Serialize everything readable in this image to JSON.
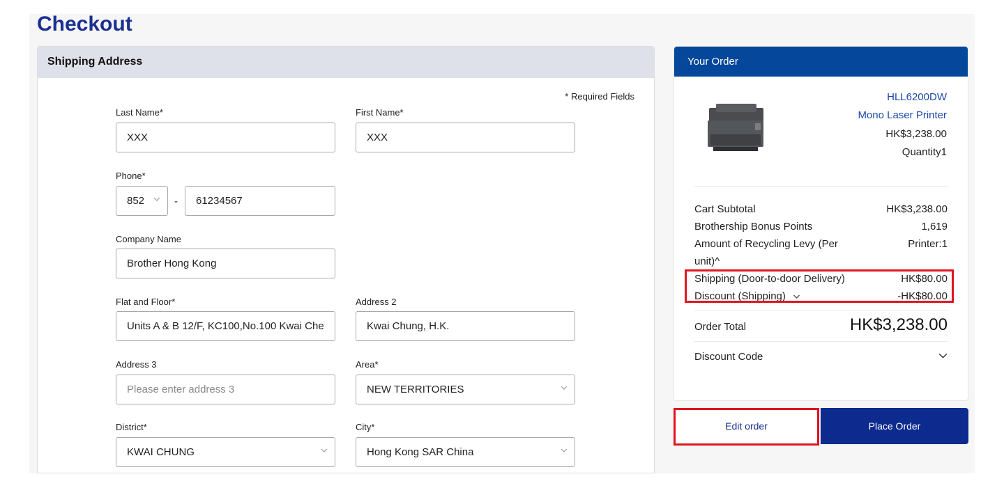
{
  "page": {
    "title": "Checkout"
  },
  "shipping": {
    "header": "Shipping Address",
    "required_note": "* Required Fields",
    "last_name": {
      "label": "Last Name*",
      "value": "XXX"
    },
    "first_name": {
      "label": "First Name*",
      "value": "XXX"
    },
    "phone": {
      "label": "Phone*",
      "country_code": "852",
      "separator": "-",
      "number": "61234567"
    },
    "company": {
      "label": "Company Name",
      "value": "Brother Hong Kong"
    },
    "flat_floor": {
      "label": "Flat and Floor*",
      "value": "Units A & B 12/F, KC100,No.100 Kwai Che"
    },
    "address2": {
      "label": "Address 2",
      "value": "Kwai Chung,  H.K."
    },
    "address3": {
      "label": "Address 3",
      "placeholder": "Please enter address 3"
    },
    "area": {
      "label": "Area*",
      "value": "NEW TERRITORIES"
    },
    "district": {
      "label": "District*",
      "value": "KWAI CHUNG"
    },
    "city": {
      "label": "City*",
      "value": "Hong Kong SAR China"
    }
  },
  "order": {
    "header": "Your Order",
    "product": {
      "model": "HLL6200DW",
      "name": "Mono Laser Printer",
      "price": "HK$3,238.00",
      "quantity": "Quantity1"
    },
    "summary": {
      "subtotal_label": "Cart Subtotal",
      "subtotal_value": "HK$3,238.00",
      "points_label": "Brothership Bonus Points",
      "points_value": "1,619",
      "levy_label_1": "Amount of Recycling Levy (Per",
      "levy_label_2": "unit)^",
      "levy_value": "Printer:1",
      "shipping_label": "Shipping (Door-to-door Delivery)",
      "shipping_value": "HK$80.00",
      "discount_label": "Discount (Shipping)",
      "discount_value": "-HK$80.00"
    },
    "total_label": "Order Total",
    "total_value": "HK$3,238.00",
    "discount_code_label": "Discount Code"
  },
  "buttons": {
    "edit": "Edit order",
    "place": "Place Order"
  },
  "colors": {
    "brand_blue": "#1b2f91",
    "header_blue": "#05479b",
    "highlight_red": "#e0141e"
  },
  "icons": [
    "chevron-down-icon",
    "printer-product-image"
  ]
}
